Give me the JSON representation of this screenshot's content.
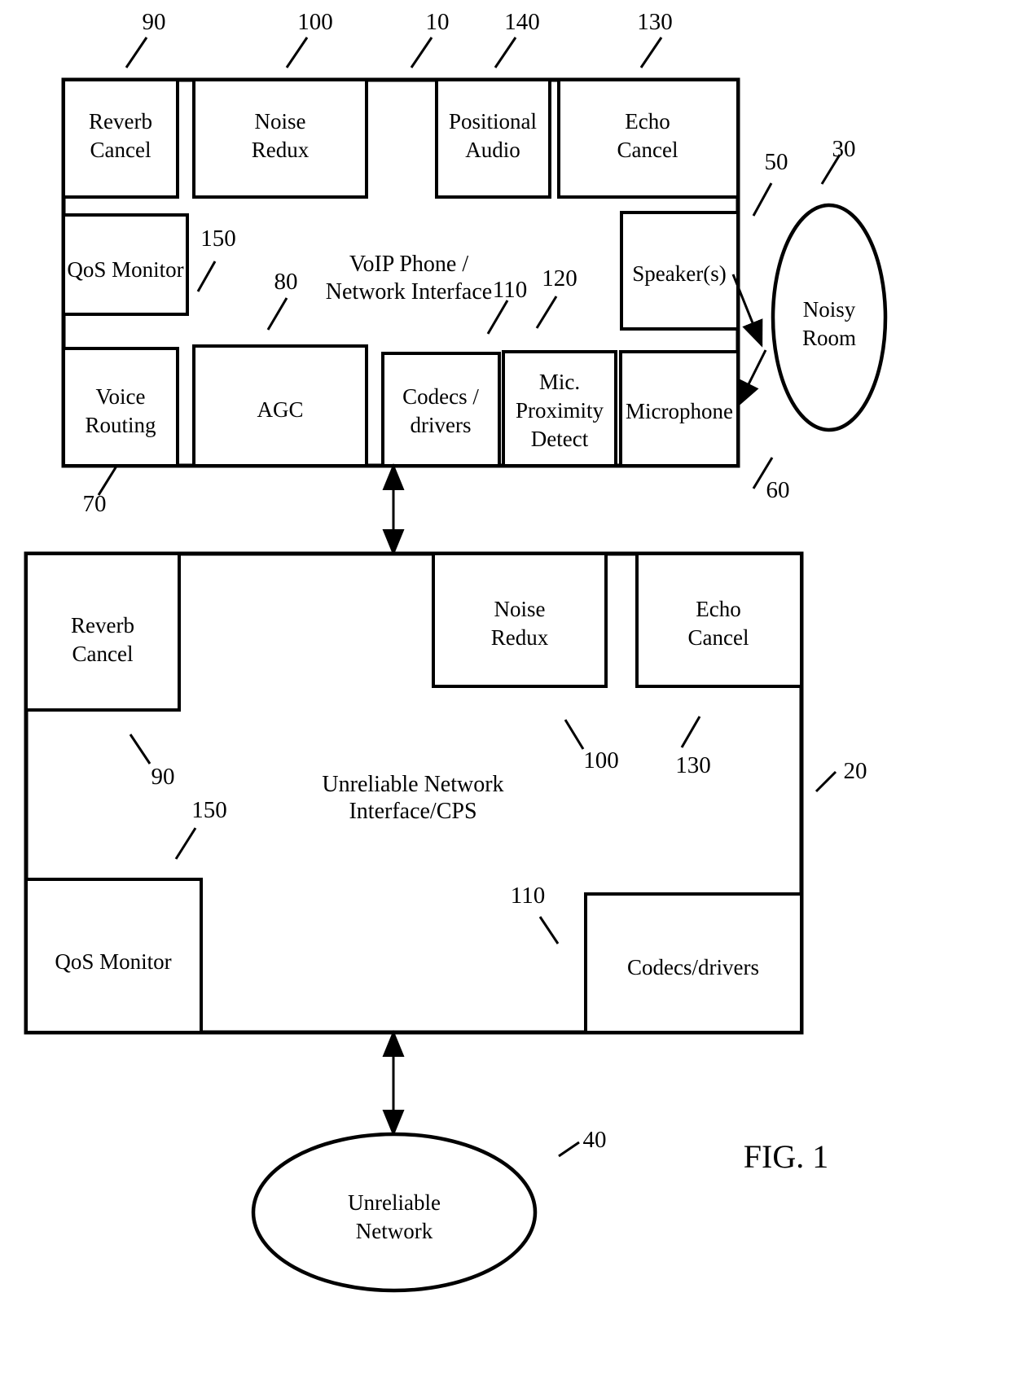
{
  "figure": {
    "caption": "FIG. 1",
    "background": "#ffffff",
    "stroke": "#000000"
  },
  "endpoint": {
    "center_label_line1": "VoIP Phone /",
    "center_label_line2": "Network Interface",
    "ref": "10",
    "blocks": {
      "reverb_cancel": {
        "line1": "Reverb",
        "line2": "Cancel",
        "ref": "90"
      },
      "noise_redux": {
        "line1": "Noise",
        "line2": "Redux",
        "ref": "100"
      },
      "positional_audio": {
        "line1": "Positional",
        "line2": "Audio",
        "ref": "140"
      },
      "echo_cancel": {
        "line1": "Echo",
        "line2": "Cancel",
        "ref": "130"
      },
      "qos_monitor": {
        "line1": "QoS Monitor",
        "ref": "150"
      },
      "speakers": {
        "line1": "Speaker(s)",
        "ref": "50"
      },
      "voice_routing": {
        "line1": "Voice",
        "line2": "Routing",
        "ref": "70"
      },
      "agc": {
        "line1": "AGC",
        "ref": "80"
      },
      "codecs_drivers": {
        "line1": "Codecs /",
        "line2": "drivers",
        "ref": "110"
      },
      "mic_proximity": {
        "line1": "Mic.",
        "line2": "Proximity",
        "line3": "Detect",
        "ref": "120"
      },
      "microphone": {
        "line1": "Microphone",
        "ref": "60"
      }
    }
  },
  "noisy_room": {
    "line1": "Noisy",
    "line2": "Room",
    "ref": "30"
  },
  "network_node": {
    "center_label_line1": "Unreliable Network",
    "center_label_line2": "Interface/CPS",
    "ref": "20",
    "blocks": {
      "reverb_cancel": {
        "line1": "Reverb",
        "line2": "Cancel",
        "ref": "90"
      },
      "noise_redux": {
        "line1": "Noise",
        "line2": "Redux",
        "ref": "100"
      },
      "echo_cancel": {
        "line1": "Echo",
        "line2": "Cancel",
        "ref": "130"
      },
      "qos_monitor": {
        "line1": "QoS Monitor",
        "ref": "150"
      },
      "codecs_drivers": {
        "line1": "Codecs/drivers",
        "ref": "110"
      }
    }
  },
  "unreliable_network": {
    "line1": "Unreliable",
    "line2": "Network",
    "ref": "40"
  }
}
